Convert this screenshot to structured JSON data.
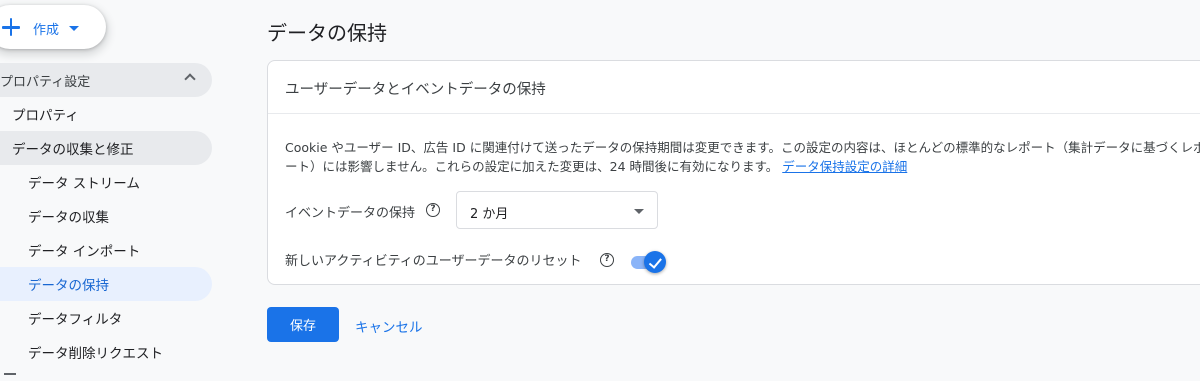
{
  "sidebar": {
    "create_label": "作成",
    "section_label": "プロパティ設定",
    "items": [
      {
        "label": "プロパティ"
      },
      {
        "label": "データの収集と修正"
      },
      {
        "label": "データ ストリーム"
      },
      {
        "label": "データの収集"
      },
      {
        "label": "データ インポート"
      },
      {
        "label": "データの保持"
      },
      {
        "label": "データフィルタ"
      },
      {
        "label": "データ削除リクエスト"
      }
    ]
  },
  "main": {
    "title": "データの保持",
    "card_title": "ユーザーデータとイベントデータの保持",
    "description": "Cookie やユーザー ID、広告 ID に関連付けて送ったデータの保持期間は変更できます。この設定の内容は、ほとんどの標準的なレポート（集計データに基づくレポート）には影響しません。これらの設定に加えた変更は、24 時間後に有効になります。",
    "learn_more_link": "データ保持設定の詳細",
    "event_retention_label": "イベントデータの保持",
    "event_retention_value": "2 か月",
    "reset_label": "新しいアクティビティのユーザーデータのリセット",
    "reset_enabled": true,
    "help_glyph": "?"
  },
  "actions": {
    "save_label": "保存",
    "cancel_label": "キャンセル"
  },
  "colors": {
    "accent": "#1a73e8",
    "selected_bg": "#e8f0fe",
    "group_bg": "#e8eaed"
  }
}
